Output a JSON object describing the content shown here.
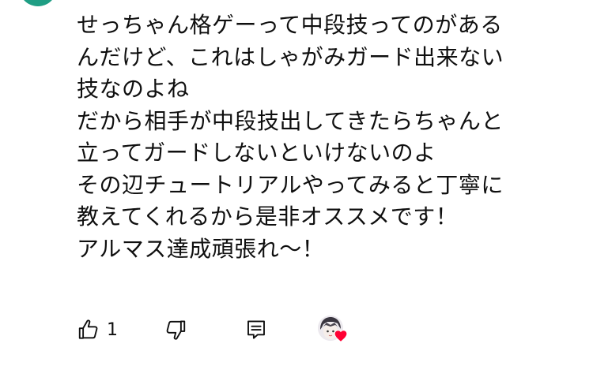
{
  "comment": {
    "lines": [
      "せっちゃん格ゲーって中段技ってのがある",
      "んだけど、これはしゃがみガード出来ない",
      "技なのよね",
      "だから相手が中段技出してきたらちゃんと",
      "立ってガードしないといけないのよ",
      "その辺チュートリアルやってみると丁寧に",
      "教えてくれるから是非オススメです！",
      "アルマス達成頑張れ〜！"
    ]
  },
  "actions": {
    "like_count": "1",
    "like_icon": "thumb-up-icon",
    "dislike_icon": "thumb-down-icon",
    "reply_icon": "reply-icon",
    "hearted_icon": "heart-icon"
  },
  "colors": {
    "text": "#0f0f0f",
    "heart": "#ff0033",
    "avatar_partial": "#1f9e84"
  }
}
